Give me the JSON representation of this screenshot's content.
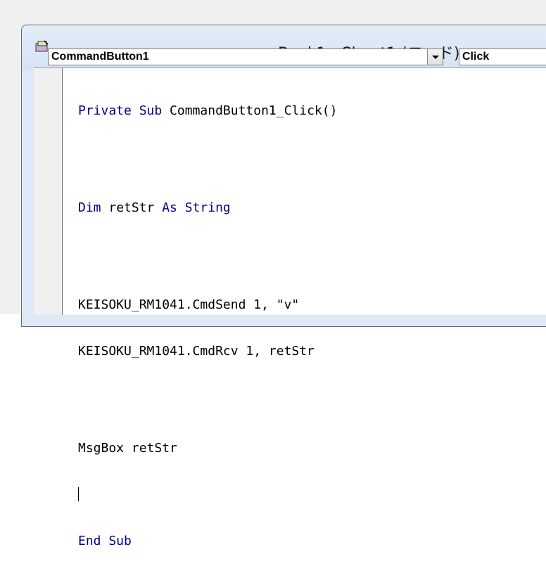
{
  "window": {
    "title": "Book1 - Sheet1 (コード)",
    "icon": "vba-module-icon"
  },
  "toolbar": {
    "object_combo_value": "CommandButton1",
    "procedure_combo_value": "Click",
    "dropdown_icon": "chevron-down-icon"
  },
  "code": {
    "line1_kw1": "Private Sub",
    "line1_rest": " CommandButton1_Click()",
    "line2_kw": "Dim",
    "line2_mid": " retStr ",
    "line2_kw2": "As String",
    "line3": "KEISOKU_RM1041.CmdSend 1, \"v\"",
    "line4": "KEISOKU_RM1041.CmdRcv 1, retStr",
    "line5": "MsgBox retStr",
    "line7_kw": "End Sub"
  },
  "colors": {
    "keyword": "#00008b",
    "text": "#000000",
    "title_bg": "#dfe9f5"
  }
}
